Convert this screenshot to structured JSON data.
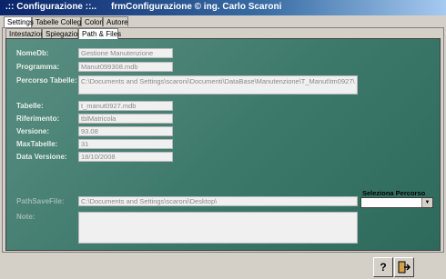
{
  "window": {
    "app_title": ".:: Configurazione ::..",
    "form_title": "frmConfigurazione © ing. Carlo Scaroni"
  },
  "outer_tabs": [
    {
      "label": "Settings",
      "active": true
    },
    {
      "label": "Tabelle Collegate",
      "active": false
    },
    {
      "label": "Colori",
      "active": false
    },
    {
      "label": "Autore",
      "active": false
    }
  ],
  "inner_tabs": [
    {
      "label": "Intestazione",
      "active": false
    },
    {
      "label": "Spiegazioni",
      "active": false
    },
    {
      "label": "Path & Files",
      "active": true
    }
  ],
  "fields": {
    "nomedb": {
      "label": "NomeDb:",
      "value": "Gestione Manutenzione"
    },
    "programma": {
      "label": "Programma:",
      "value": "Manut099308.mdb"
    },
    "percorso": {
      "label": "Percorso Tabelle:",
      "value": "C:\\Documents and Settings\\scaroni\\Documenti\\DataBase\\Manutenzione\\T_Manut\\tm0927\\"
    },
    "tabelle": {
      "label": "Tabelle:",
      "value": "t_manut0927.mdb"
    },
    "riferimento": {
      "label": "Riferimento:",
      "value": "tblMatricola"
    },
    "versione": {
      "label": "Versione:",
      "value": "93.08"
    },
    "maxtabelle": {
      "label": "MaxTabelle:",
      "value": "31"
    },
    "dataversione": {
      "label": "Data Versione:",
      "value": "18/10/2008"
    },
    "pathsavefile": {
      "label": "PathSaveFile:",
      "value": "C:\\Documents and Settings\\scaroni\\Desktop\\"
    },
    "note": {
      "label": "Note:",
      "value": ""
    }
  },
  "seleziona": {
    "label": "Seleziona Percorso",
    "value": ""
  },
  "toolbar": {
    "help_icon": "help-icon",
    "exit_icon": "exit-icon"
  }
}
